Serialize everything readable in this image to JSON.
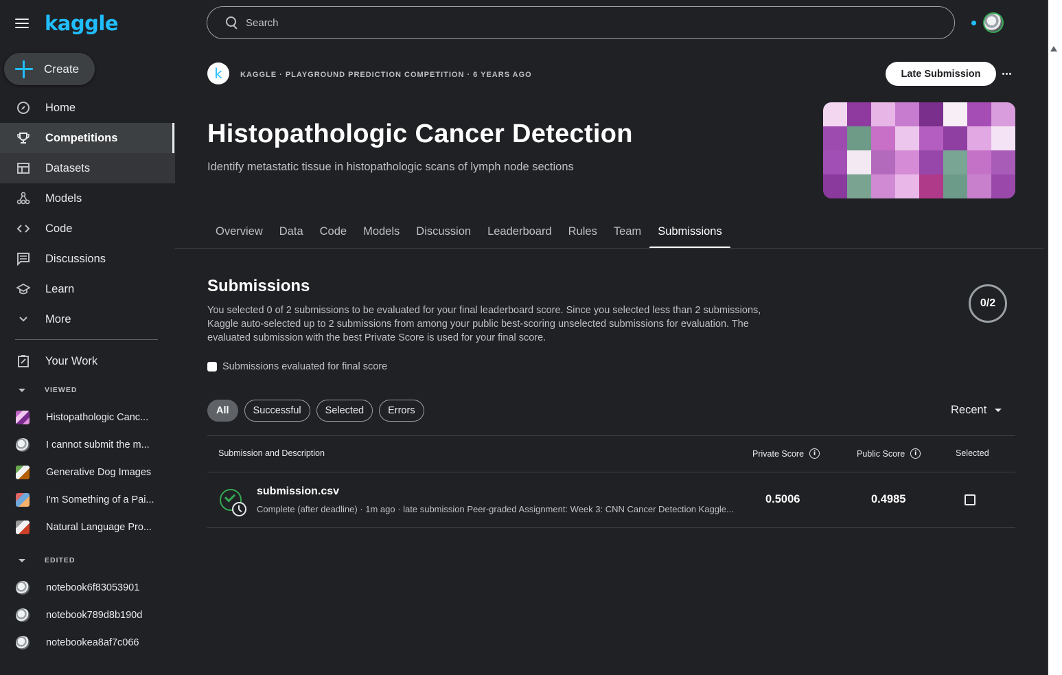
{
  "sidebar": {
    "brand": "kaggle",
    "create_label": "Create",
    "nav": [
      {
        "label": "Home",
        "icon": "compass-icon"
      },
      {
        "label": "Competitions",
        "icon": "trophy-icon"
      },
      {
        "label": "Datasets",
        "icon": "table-icon"
      },
      {
        "label": "Models",
        "icon": "models-icon"
      },
      {
        "label": "Code",
        "icon": "code-icon"
      },
      {
        "label": "Discussions",
        "icon": "comments-icon"
      },
      {
        "label": "Learn",
        "icon": "school-icon"
      },
      {
        "label": "More",
        "icon": "chevron-down-icon"
      }
    ],
    "your_work": "Your Work",
    "viewed_label": "VIEWED",
    "viewed": [
      "Histopathologic Canc...",
      "I cannot submit the m...",
      "Generative Dog Images",
      "I'm Something of a Pai...",
      "Natural Language Pro..."
    ],
    "edited_label": "EDITED",
    "edited": [
      "notebook6f83053901",
      "notebook789d8b190d",
      "notebookea8af7c066"
    ]
  },
  "search": {
    "placeholder": "Search"
  },
  "competition": {
    "logo_letter": "k",
    "meta": "KAGGLE · PLAYGROUND PREDICTION COMPETITION · 6 YEARS AGO",
    "late_submission": "Late Submission",
    "title": "Histopathologic Cancer Detection",
    "subtitle": "Identify metastatic tissue in histopathologic scans of lymph node sections"
  },
  "tabs": [
    "Overview",
    "Data",
    "Code",
    "Models",
    "Discussion",
    "Leaderboard",
    "Rules",
    "Team",
    "Submissions"
  ],
  "submissions": {
    "title": "Submissions",
    "description": "You selected 0 of 2 submissions to be evaluated for your final leaderboard score. Since you selected less than 2 submissions, Kaggle auto-selected up to 2 submissions from among your public best-scoring unselected submissions for evaluation. The evaluated submission with the best Private Score is used for your final score.",
    "counter": "0/2",
    "final_checkbox_label": "Submissions evaluated for final score",
    "filters": [
      "All",
      "Successful",
      "Selected",
      "Errors"
    ],
    "sort_label": "Recent",
    "columns": {
      "description": "Submission and Description",
      "private": "Private Score",
      "public": "Public Score",
      "selected": "Selected"
    },
    "rows": [
      {
        "file": "submission.csv",
        "detail": "Complete (after deadline) · 1m ago · late submission Peer-graded Assignment: Week 3: CNN Cancer Detection Kaggle...",
        "private_score": "0.5006",
        "public_score": "0.4985"
      }
    ]
  },
  "colors": {
    "background": "#202124",
    "brand_blue": "#20beff",
    "success_green": "#34a853"
  }
}
